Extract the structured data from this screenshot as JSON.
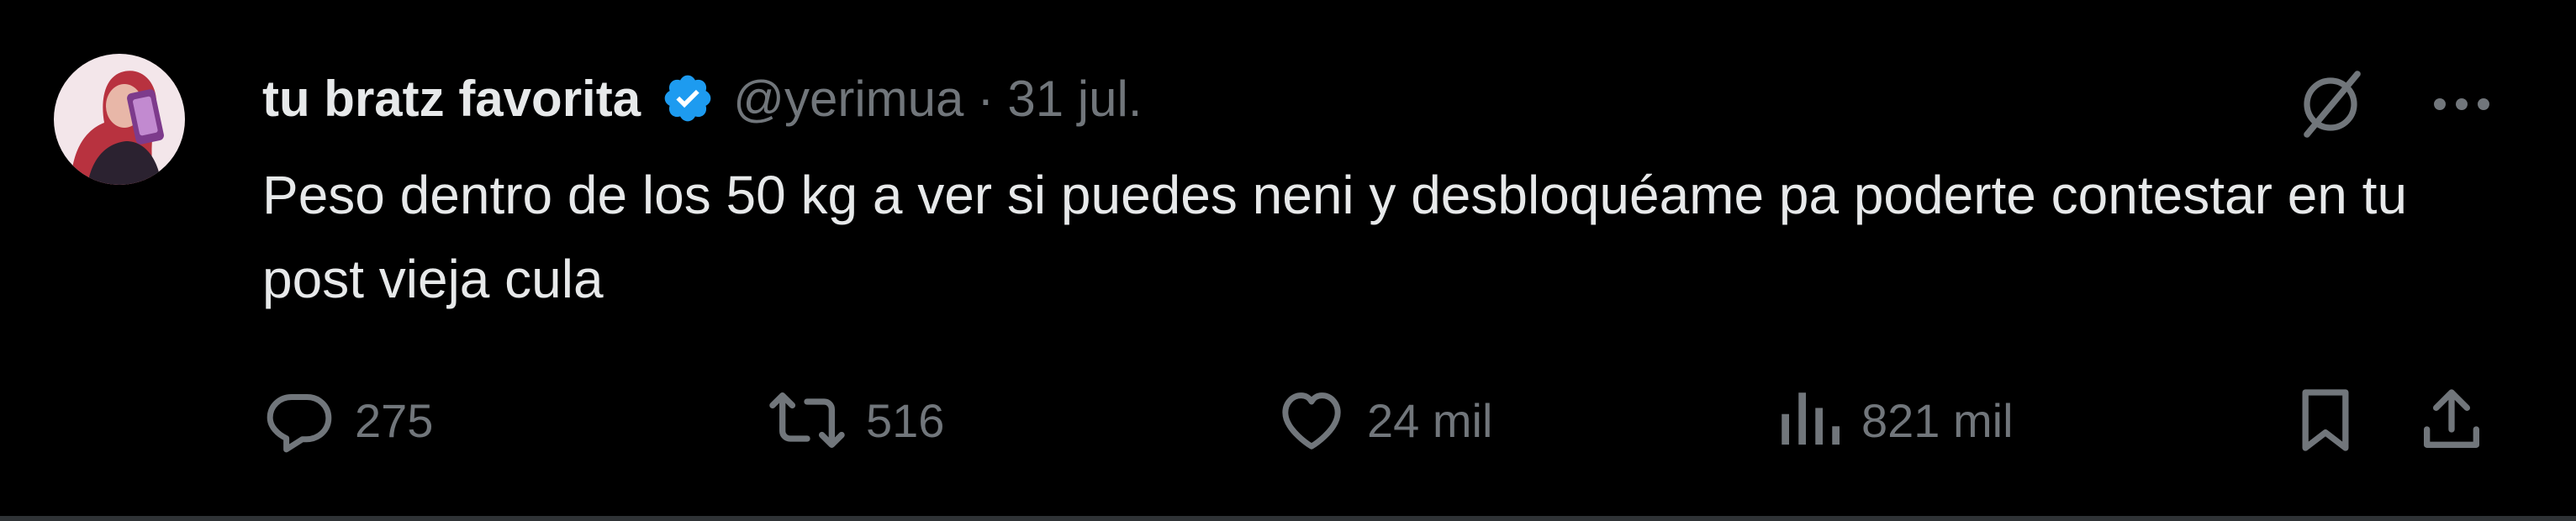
{
  "tweet": {
    "display_name": "tu bratz favorita",
    "handle": "@yerimua",
    "separator": "·",
    "date": "31 jul.",
    "text": "Peso dentro de los 50 kg a ver si puedes neni y desbloquéame pa poderte contestar en tu post vieja cula",
    "verified_icon": "verified-badge-icon",
    "colors": {
      "background": "#000000",
      "text": "#e7e9ea",
      "muted": "#71767b",
      "verified": "#1d9bf0",
      "divider": "#2f3336"
    }
  },
  "actions": {
    "replies": "275",
    "reposts": "516",
    "likes": "24 mil",
    "views": "821 mil"
  },
  "icons": {
    "grok": "grok-icon",
    "more": "more-icon",
    "reply": "reply-icon",
    "repost": "repost-icon",
    "like": "heart-icon",
    "views": "views-icon",
    "bookmark": "bookmark-icon",
    "share": "share-icon"
  }
}
